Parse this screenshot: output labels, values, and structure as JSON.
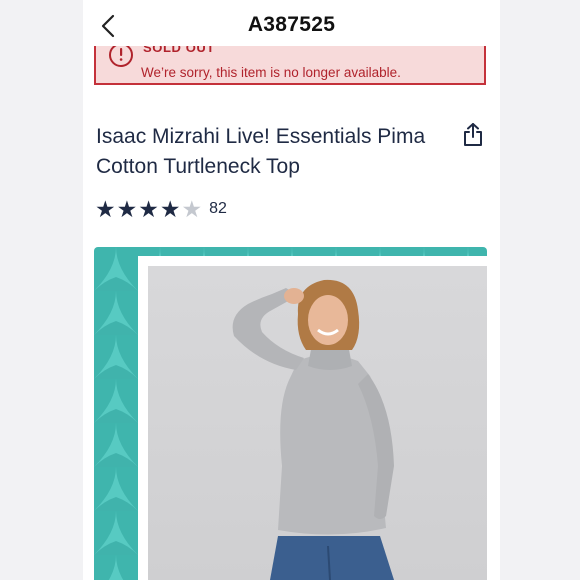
{
  "header": {
    "title": "A387525",
    "back_icon": "chevron-left-icon"
  },
  "banner": {
    "title": "SOLD OUT",
    "message": "We’re sorry, this item is no longer available.",
    "icon": "alert-circle-icon",
    "colors": {
      "text": "#b0232c",
      "background": "#f7dada",
      "border": "#c4313a"
    }
  },
  "product": {
    "title": "Isaac Mizrahi Live! Essentials Pima Cotton Turtleneck Top",
    "share_icon": "share-icon"
  },
  "rating": {
    "value": 4,
    "max": 5,
    "count": "82"
  },
  "image": {
    "frame_color": "#3fb5ad",
    "alt": "Model wearing a light grey turtleneck top and blue jeans"
  }
}
